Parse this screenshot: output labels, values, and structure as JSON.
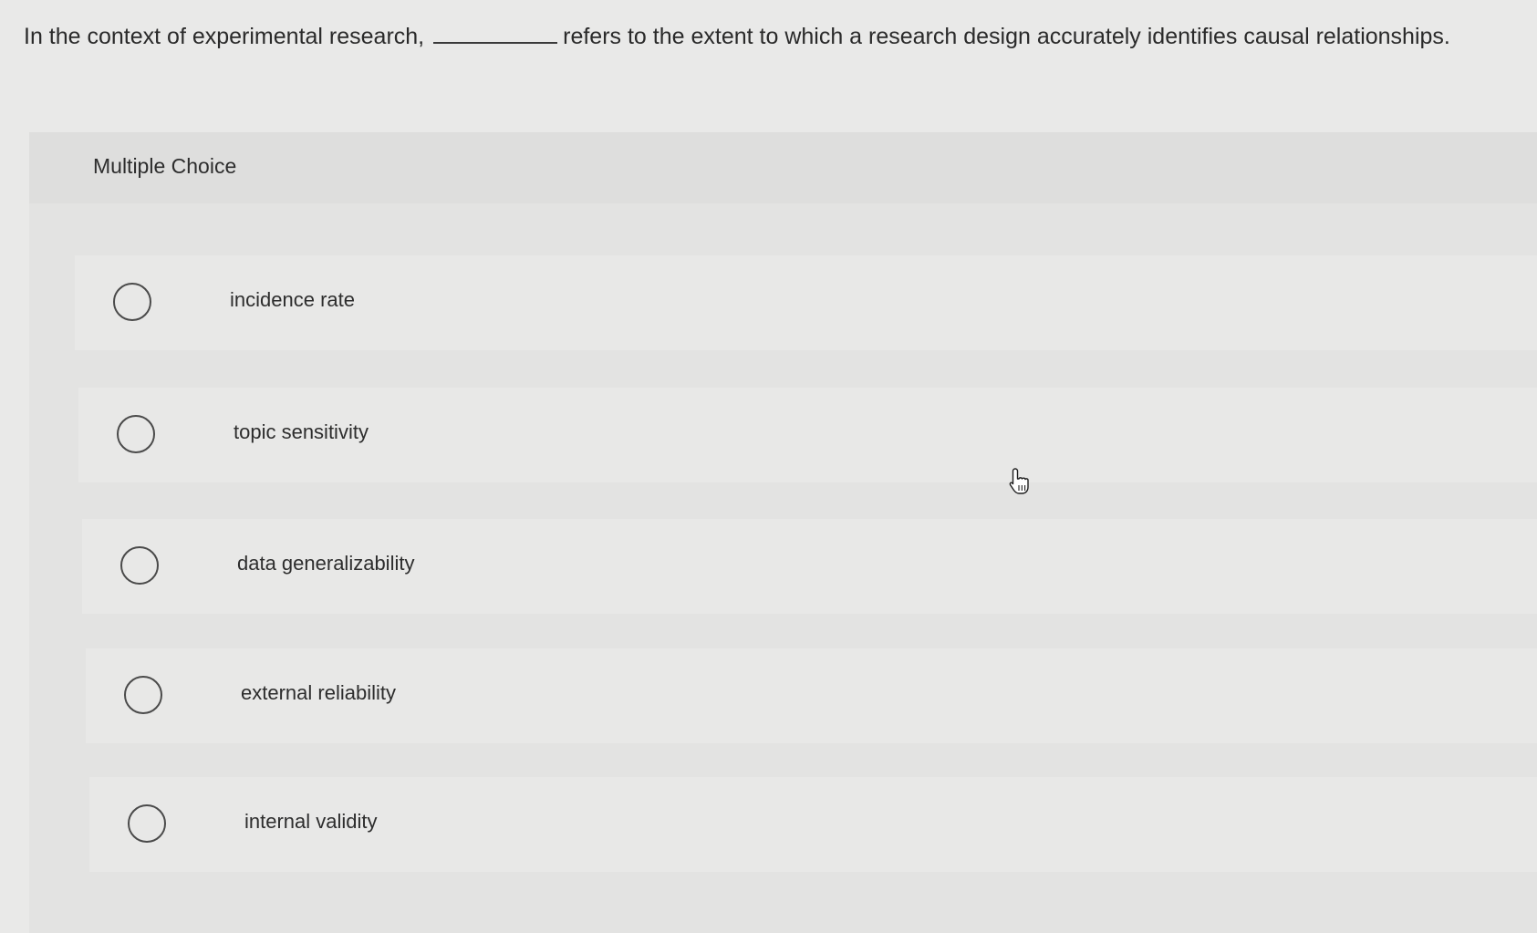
{
  "question": {
    "before_blank": "In the context of experimental research,",
    "after_blank": "refers to the extent to which a research design accurately identifies causal relationships."
  },
  "panel": {
    "title": "Multiple Choice"
  },
  "options": [
    {
      "label": "incidence rate",
      "selected": false
    },
    {
      "label": "topic sensitivity",
      "selected": false
    },
    {
      "label": "data generalizability",
      "selected": false
    },
    {
      "label": "external reliability",
      "selected": false
    },
    {
      "label": "internal validity",
      "selected": false
    }
  ],
  "cursor": {
    "icon": "hand-pointer-icon"
  }
}
